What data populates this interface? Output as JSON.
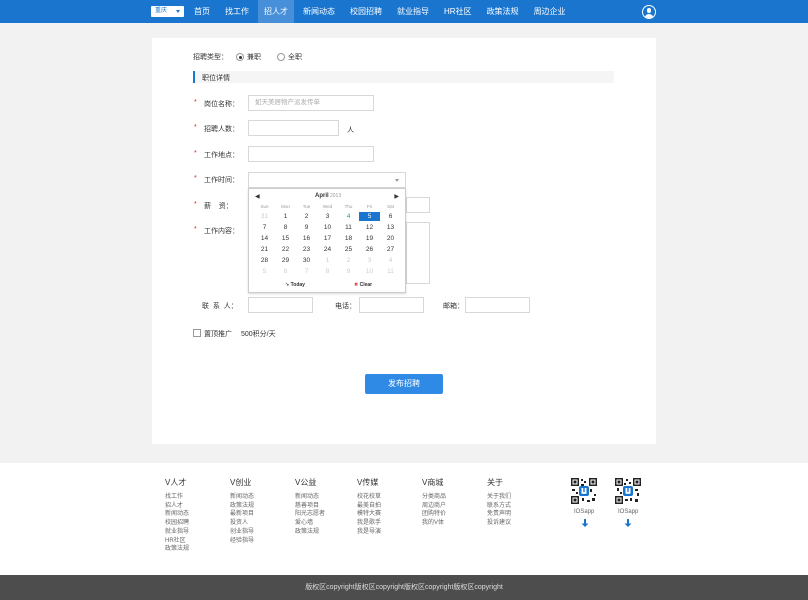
{
  "header": {
    "city": "重庆",
    "nav": [
      "首页",
      "找工作",
      "招人才",
      "新闻动态",
      "校园招聘",
      "就业指导",
      "HR社区",
      "政策法规",
      "周边企业"
    ],
    "active_index": 2
  },
  "form": {
    "type_label": "招聘类型：",
    "type_options": [
      "兼职",
      "全职"
    ],
    "type_selected": 0,
    "section_title": "职位详情",
    "position_label": "岗位名称：",
    "position_placeholder": "如天美居物产派发传单",
    "count_label": "招聘人数：",
    "count_unit": "人",
    "location_label": "工作地点：",
    "time_label": "工作时间：",
    "salary_label": "薪    资：",
    "content_label": "工作内容：",
    "contact_label": "联  系  人：",
    "phone_label": "电话：",
    "email_label": "邮箱：",
    "promo_label": "置顶推广",
    "promo_value": "500积分/天",
    "submit_label": "发布招聘",
    "required_mark": "*"
  },
  "datepicker": {
    "prev": "◀",
    "next": "▶",
    "month": "April",
    "year": "2013",
    "weekdays": [
      "Sun",
      "Mon",
      "Tue",
      "Wed",
      "Thu",
      "Fri",
      "Sat"
    ],
    "weeks": [
      [
        "31",
        "1",
        "2",
        "3",
        "4",
        "5",
        "6"
      ],
      [
        "7",
        "8",
        "9",
        "10",
        "11",
        "12",
        "13"
      ],
      [
        "14",
        "15",
        "16",
        "17",
        "18",
        "19",
        "20"
      ],
      [
        "21",
        "22",
        "23",
        "24",
        "25",
        "26",
        "27"
      ],
      [
        "28",
        "29",
        "30",
        "1",
        "2",
        "3",
        "4"
      ],
      [
        "5",
        "6",
        "7",
        "8",
        "9",
        "10",
        "11"
      ]
    ],
    "today_label": "Today",
    "clear_label": "Clear",
    "today_mark": "↘",
    "clear_mark": "✖"
  },
  "footer": {
    "columns": [
      {
        "title": "V人才",
        "links": [
          "找工作",
          "招人才",
          "新闻动态",
          "校园招聘",
          "就业指导",
          "HR社区",
          "政策法规"
        ]
      },
      {
        "title": "V创业",
        "links": [
          "新闻动态",
          "政策法规",
          "最新项目",
          "投资人",
          "创业指导",
          "经验指导"
        ]
      },
      {
        "title": "V公益",
        "links": [
          "新闻动态",
          "慈善项目",
          "阳光志愿者",
          "爱心墙",
          "政策法规"
        ]
      },
      {
        "title": "V传媒",
        "links": [
          "校花校草",
          "最美自拍",
          "模特大赛",
          "我是歌手",
          "我是导演"
        ]
      },
      {
        "title": "V商城",
        "links": [
          "分类商品",
          "周边商户",
          "团购特价",
          "我的V体"
        ]
      },
      {
        "title": "关于",
        "links": [
          "关于我们",
          "联系方式",
          "免责声明",
          "投诉建议"
        ]
      }
    ],
    "apps": [
      "IOSapp",
      "IOSapp"
    ],
    "copyright": "版权区copyright版权区copyright版权区copyright版权区copyright"
  }
}
